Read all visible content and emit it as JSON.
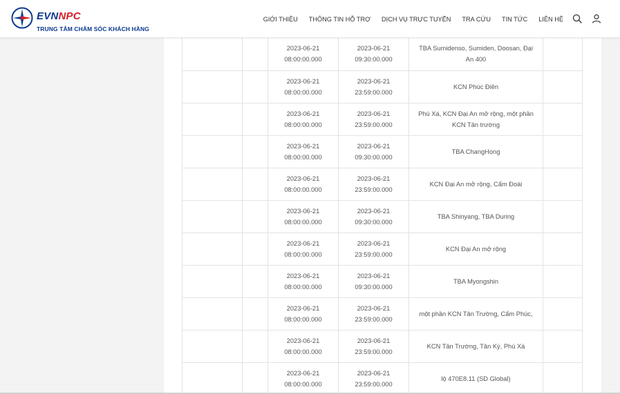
{
  "header": {
    "brand_part1": "EVN",
    "brand_part2": "NPC",
    "subtitle": "TRUNG TÂM CHĂM SÓC KHÁCH HÀNG",
    "colors": {
      "brand_blue": "#0b3a8f",
      "brand_red": "#d21e2b"
    },
    "nav": [
      {
        "label": "Giới thiệu"
      },
      {
        "label": "Thông tin hỗ trợ"
      },
      {
        "label": "Dịch vụ trực tuyến"
      },
      {
        "label": "Tra cứu"
      },
      {
        "label": "Tin tức"
      },
      {
        "label": "Liên hệ"
      }
    ],
    "icons": {
      "search": "search-icon",
      "user": "user-icon"
    }
  },
  "table": {
    "rows": [
      {
        "c1": "",
        "c2": "",
        "start_date": "2023-06-21",
        "start_time": "08:00:00.000",
        "end_date": "2023-06-21",
        "end_time": "09:30:00.000",
        "area": "TBA Sumidenso, Sumiden, Doosan, Đại An 400",
        "c6": ""
      },
      {
        "c1": "",
        "c2": "",
        "start_date": "2023-06-21",
        "start_time": "08:00:00.000",
        "end_date": "2023-06-21",
        "end_time": "23:59:00.000",
        "area": "KCN Phúc Điền",
        "c6": ""
      },
      {
        "c1": "",
        "c2": "",
        "start_date": "2023-06-21",
        "start_time": "08:00:00.000",
        "end_date": "2023-06-21",
        "end_time": "23:59:00.000",
        "area": "Phú Xá, KCN Đại An mở rộng, một phần KCN Tân trường",
        "c6": ""
      },
      {
        "c1": "",
        "c2": "",
        "start_date": "2023-06-21",
        "start_time": "08:00:00.000",
        "end_date": "2023-06-21",
        "end_time": "09:30:00.000",
        "area": "TBA ChangHong",
        "c6": ""
      },
      {
        "c1": "",
        "c2": "",
        "start_date": "2023-06-21",
        "start_time": "08:00:00.000",
        "end_date": "2023-06-21",
        "end_time": "23:59:00.000",
        "area": "KCN Đại An mở rộng, Cẩm Đoài",
        "c6": ""
      },
      {
        "c1": "",
        "c2": "",
        "start_date": "2023-06-21",
        "start_time": "08:00:00.000",
        "end_date": "2023-06-21",
        "end_time": "09:30:00.000",
        "area": "TBA Shinyang, TBA During",
        "c6": ""
      },
      {
        "c1": "",
        "c2": "",
        "start_date": "2023-06-21",
        "start_time": "08:00:00.000",
        "end_date": "2023-06-21",
        "end_time": "23:59:00.000",
        "area": "KCN Đại An mở rộng",
        "c6": ""
      },
      {
        "c1": "",
        "c2": "",
        "start_date": "2023-06-21",
        "start_time": "08:00:00.000",
        "end_date": "2023-06-21",
        "end_time": "09:30:00.000",
        "area": "TBA Myongshin",
        "c6": ""
      },
      {
        "c1": "",
        "c2": "",
        "start_date": "2023-06-21",
        "start_time": "08:00:00.000",
        "end_date": "2023-06-21",
        "end_time": "23:59:00.000",
        "area": "một phần KCN Tân Trường, Cẩm Phúc,",
        "c6": ""
      },
      {
        "c1": "",
        "c2": "",
        "start_date": "2023-06-21",
        "start_time": "08:00:00.000",
        "end_date": "2023-06-21",
        "end_time": "23:59:00.000",
        "area": "KCN Tân Trường, Tân Kỳ, Phú Xá",
        "c6": ""
      },
      {
        "c1": "",
        "c2": "",
        "start_date": "2023-06-21",
        "start_time": "08:00:00.000",
        "end_date": "2023-06-21",
        "end_time": "23:59:00.000",
        "area": "lộ 470E8.11 (SD Global)",
        "c6": ""
      }
    ]
  }
}
